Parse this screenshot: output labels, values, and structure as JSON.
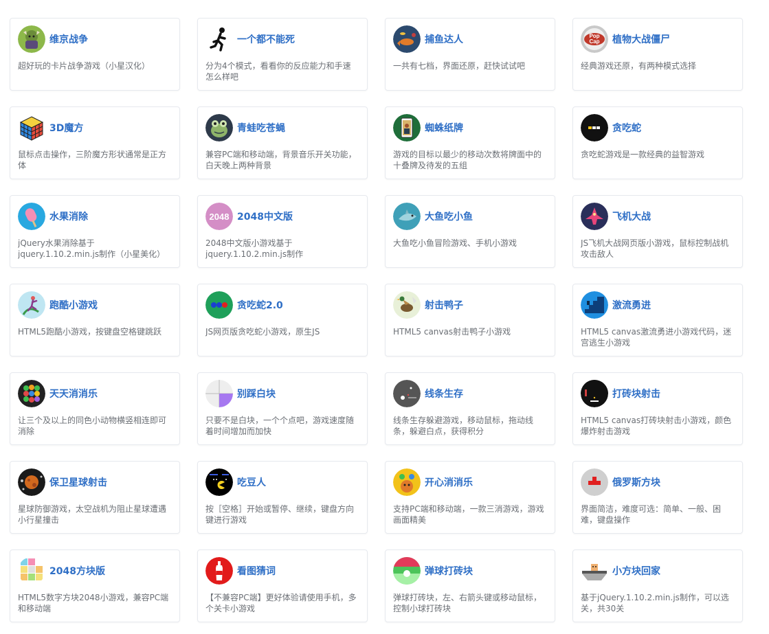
{
  "games": [
    {
      "title": "维京战争",
      "desc": "超好玩的卡片战争游戏（小星汉化）",
      "icon": "viking-warrior-icon",
      "bg": "#8db84a"
    },
    {
      "title": "一个都不能死",
      "desc": "分为4个模式，看看你的反应能力和手速怎么样吧",
      "icon": "running-man-icon",
      "bg": "#ffffff"
    },
    {
      "title": "捕鱼达人",
      "desc": "一共有七档，界面还原，赶快试试吧",
      "icon": "fish-icon",
      "bg": "#2c4a6e"
    },
    {
      "title": "植物大战僵尸",
      "desc": "经典游戏还原，有两种模式选择",
      "icon": "popcap-logo-icon",
      "bg": "#c9c9c9"
    },
    {
      "title": "3D魔方",
      "desc": "鼠标点击操作，三阶魔方形状通常是正方体",
      "icon": "rubiks-cube-icon",
      "bg": "#ffffff"
    },
    {
      "title": "青蛙吃苍蝇",
      "desc": "兼容PC端和移动端，背景音乐开关功能，白天晚上两种背景",
      "icon": "frog-icon",
      "bg": "#2e3a4a"
    },
    {
      "title": "蜘蛛纸牌",
      "desc": "游戏的目标以最少的移动次数将牌面中的十叠牌及待发的五组",
      "icon": "playing-card-icon",
      "bg": "#1f6e3a"
    },
    {
      "title": "贪吃蛇",
      "desc": "贪吃蛇游戏是一款经典的益智游戏",
      "icon": "snake-icon",
      "bg": "#111111"
    },
    {
      "title": "水果消除",
      "desc": "jQuery水果消除基于jquery.1.10.2.min.js制作（小星美化）",
      "icon": "popsicle-icon",
      "bg": "#29a8e0"
    },
    {
      "title": "2048中文版",
      "desc": "2048中文版小游戏基于jquery.1.10.2.min.js制作",
      "icon": "number-2048-icon",
      "bg": "#d48ec6",
      "label": "2048"
    },
    {
      "title": "大鱼吃小鱼",
      "desc": "大鱼吃小鱼冒险游戏、手机小游戏",
      "icon": "shark-icon",
      "bg": "#3fa0b8"
    },
    {
      "title": "飞机大战",
      "desc": "JS飞机大战网页版小游戏，鼠标控制战机攻击敌人",
      "icon": "fighter-jet-icon",
      "bg": "#2a2f5a"
    },
    {
      "title": "跑酷小游戏",
      "desc": "HTML5跑酷小游戏，按键盘空格键跳跃",
      "icon": "parkour-icon",
      "bg": "#bfe6f2"
    },
    {
      "title": "贪吃蛇2.0",
      "desc": "JS网页版贪吃蛇小游戏，原生JS",
      "icon": "snake-dots-icon",
      "bg": "#1fa05a"
    },
    {
      "title": "射击鸭子",
      "desc": "HTML5 canvas射击鸭子小游戏",
      "icon": "duck-icon",
      "bg": "#e8f0d8"
    },
    {
      "title": "激流勇进",
      "desc": "HTML5 canvas激流勇进小游戏代码，迷宫逃生小游戏",
      "icon": "stairs-icon",
      "bg": "#1f8fe0"
    },
    {
      "title": "天天消消乐",
      "desc": "让三个及以上的同色小动物横竖相连即可消除",
      "icon": "animal-tiles-icon",
      "bg": "#222222"
    },
    {
      "title": "别踩白块",
      "desc": "只要不是白块，一个个点吧，游戏速度随着时间增加而加快",
      "icon": "piano-tiles-icon",
      "bg": "#eeeeee"
    },
    {
      "title": "线条生存",
      "desc": "线条生存躲避游戏，移动鼠标，拖动线条，躲避白点，获得积分",
      "icon": "line-survival-icon",
      "bg": "#555555"
    },
    {
      "title": "打砖块射击",
      "desc": "HTML5 canvas打砖块射击小游戏，颜色爆炸射击游戏",
      "icon": "brick-shooter-icon",
      "bg": "#111111"
    },
    {
      "title": "保卫星球射击",
      "desc": "星球防御游戏，太空战机为阻止星球遭遇小行星撞击",
      "icon": "planet-icon",
      "bg": "#1a1a1a"
    },
    {
      "title": "吃豆人",
      "desc": "按［空格］开始或暂停、继续，键盘方向键进行游戏",
      "icon": "pacman-icon",
      "bg": "#000000"
    },
    {
      "title": "开心消消乐",
      "desc": "支持PC端和移动端，一款三消游戏，游戏画面精美",
      "icon": "happy-match-icon",
      "bg": "#f2c21a"
    },
    {
      "title": "俄罗斯方块",
      "desc": "界面简洁，难度可选：简单、一般、困难，键盘操作",
      "icon": "tetris-icon",
      "bg": "#cfcfcf"
    },
    {
      "title": "2048方块版",
      "desc": "HTML5数字方块2048小游戏，兼容PC端和移动端",
      "icon": "tile-2048-icon",
      "bg": "#ffffff"
    },
    {
      "title": "看图猜词",
      "desc": "【不兼容PC端】更好体验请使用手机，多个关卡小游戏",
      "icon": "bottle-icon",
      "bg": "#e21b1b"
    },
    {
      "title": "弹球打砖块",
      "desc": "弹球打砖块，左、右箭头键或移动鼠标，控制小球打砖块",
      "icon": "ball-brick-icon",
      "bg": "#4cc45a"
    },
    {
      "title": "小方块回家",
      "desc": "基于jQuery.1.10.2.min.js制作，可以选关，共30关",
      "icon": "little-block-icon",
      "bg": "#ffffff"
    }
  ]
}
